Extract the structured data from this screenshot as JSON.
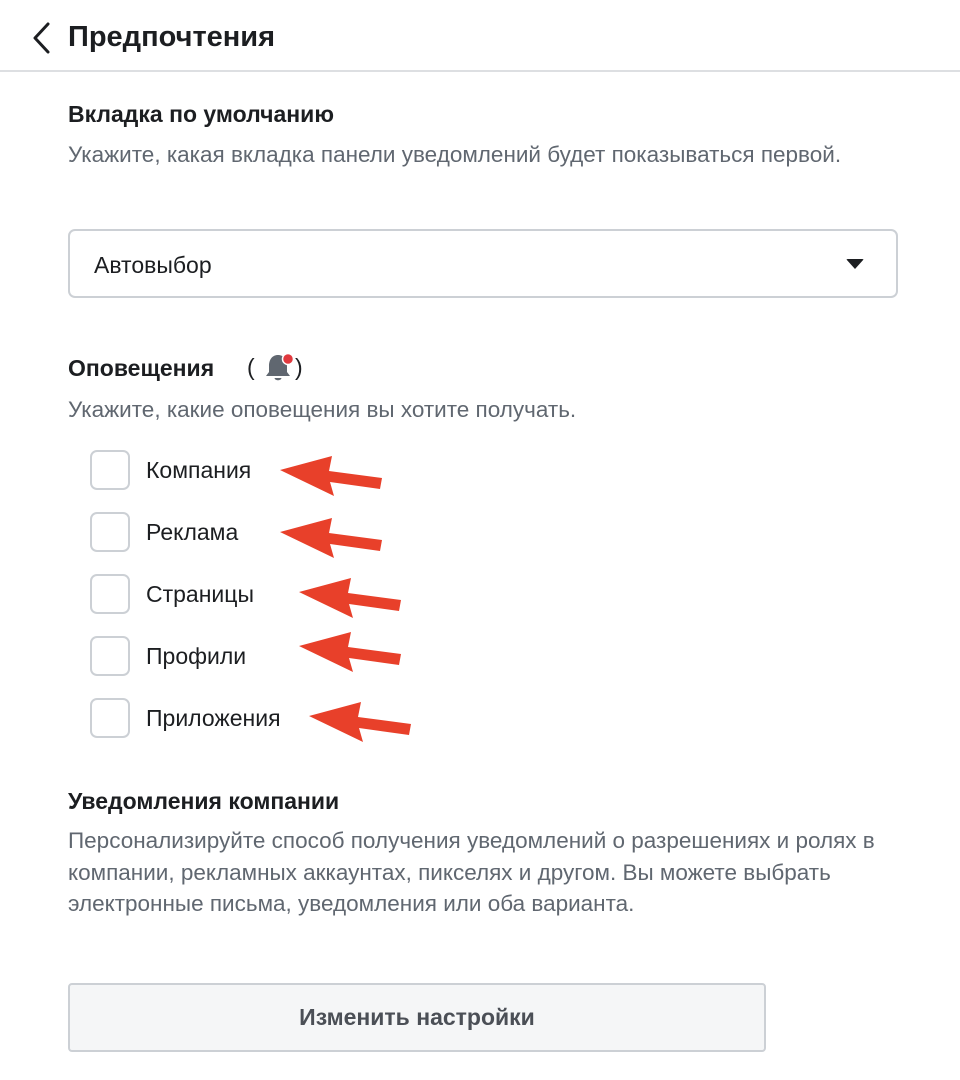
{
  "header": {
    "title": "Предпочтения",
    "back_icon": "chevron-left-icon"
  },
  "default_tab": {
    "title": "Вкладка по умолчанию",
    "description": "Укажите, какая вкладка панели уведомлений будет показываться первой.",
    "select_value": "Автовыбор",
    "select_icon": "caret-down-icon"
  },
  "alerts": {
    "title": "Оповещения",
    "paren_open": "(",
    "paren_close": ")",
    "bell_icon": "bell-with-red-dot-icon",
    "description": "Укажите, какие оповещения вы хотите получать.",
    "options": [
      {
        "label": "Компания",
        "checked": false
      },
      {
        "label": "Реклама",
        "checked": false
      },
      {
        "label": "Страницы",
        "checked": false
      },
      {
        "label": "Профили",
        "checked": false
      },
      {
        "label": "Приложения",
        "checked": false
      }
    ],
    "annotation_color": "#e8402a"
  },
  "company_notifications": {
    "title": "Уведомления компании",
    "description": "Персонализируйте способ получения уведомлений о разрешениях и ролях в компании, рекламных аккаунтах, пикселях и другом. Вы можете выбрать электронные письма, уведомления или оба варианта.",
    "button_label": "Изменить настройки"
  }
}
